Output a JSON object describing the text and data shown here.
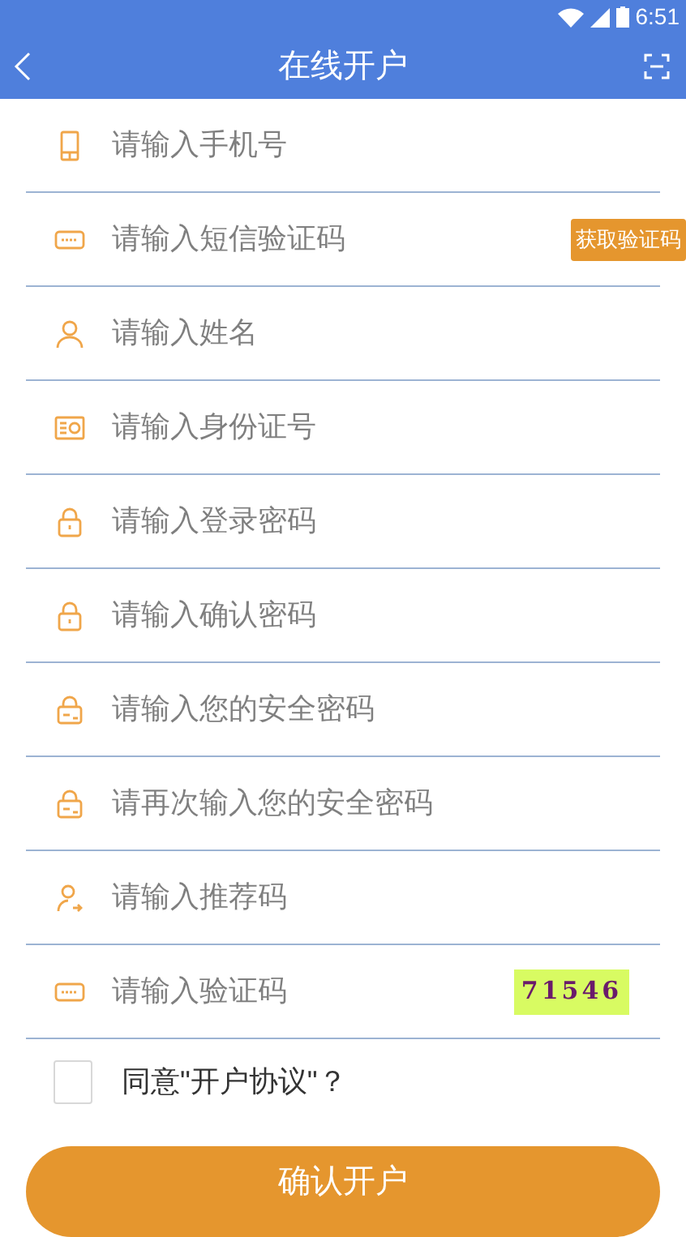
{
  "status_bar": {
    "time": "6:51"
  },
  "header": {
    "title": "在线开户"
  },
  "fields": [
    {
      "kind": "phone",
      "placeholder": "请输入手机号"
    },
    {
      "kind": "sms",
      "placeholder": "请输入短信验证码",
      "button": "获取验证码"
    },
    {
      "kind": "person",
      "placeholder": "请输入姓名"
    },
    {
      "kind": "id",
      "placeholder": "请输入身份证号"
    },
    {
      "kind": "lock",
      "placeholder": "请输入登录密码"
    },
    {
      "kind": "lock",
      "placeholder": "请输入确认密码"
    },
    {
      "kind": "safe",
      "placeholder": "请输入您的安全密码"
    },
    {
      "kind": "safe",
      "placeholder": "请再次输入您的安全密码"
    },
    {
      "kind": "referrer",
      "placeholder": "请输入推荐码"
    },
    {
      "kind": "captcha",
      "placeholder": "请输入验证码",
      "captcha": "71546"
    }
  ],
  "agreement": {
    "label": "同意\"开户协议\"？",
    "checked": false
  },
  "submit": "确认开户"
}
